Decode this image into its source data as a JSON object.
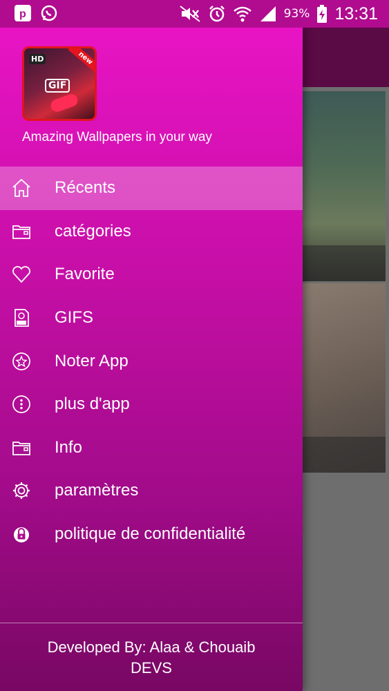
{
  "status_bar": {
    "battery": "93%",
    "time": "13:31"
  },
  "drawer": {
    "tagline": "Amazing Wallpapers in your way",
    "logo": {
      "badge_hd": "HD",
      "badge_new": "new",
      "badge_gif": "GIF"
    },
    "menu": [
      {
        "label": "Récents",
        "icon": "home-icon",
        "active": true
      },
      {
        "label": "catégories",
        "icon": "folder-icon"
      },
      {
        "label": "Favorite",
        "icon": "heart-icon"
      },
      {
        "label": "GIFS",
        "icon": "gif-file-icon"
      },
      {
        "label": "Noter App",
        "icon": "star-icon"
      },
      {
        "label": "plus d'app",
        "icon": "more-dots-icon"
      },
      {
        "label": "Info",
        "icon": "folder-icon"
      },
      {
        "label": "paramètres",
        "icon": "gear-icon"
      },
      {
        "label": "politique de confidentialité",
        "icon": "lock-icon"
      }
    ],
    "footer": {
      "line1": "Developed By: Alaa & Chouaib",
      "line2": "DEVS"
    }
  },
  "colors": {
    "drawer_top": "#e814c4",
    "drawer_bottom": "#780863",
    "status_bar": "#b10b8f"
  }
}
